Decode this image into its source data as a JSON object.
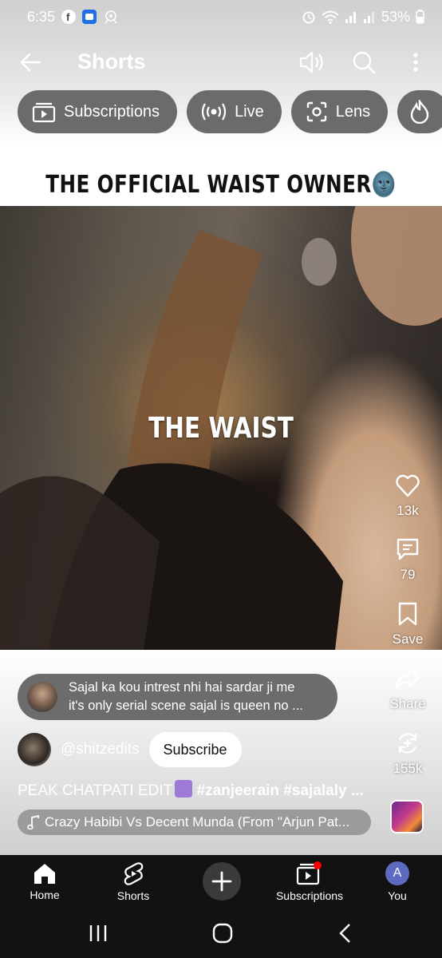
{
  "status_bar": {
    "time": "6:35",
    "battery": "53%",
    "left_icons": [
      "facebook-icon",
      "app-notification-icon",
      "gallery-icon"
    ],
    "right_icons": [
      "alarm-icon",
      "wifi-icon",
      "signal-icon",
      "signal-icon-2",
      "battery-icon"
    ]
  },
  "header": {
    "title": "Shorts",
    "back_icon": "arrow-left-icon",
    "actions": [
      "volume-icon",
      "search-icon",
      "more-vert-icon"
    ]
  },
  "chips": [
    {
      "label": "Subscriptions",
      "icon": "subscriptions-icon"
    },
    {
      "label": "Live",
      "icon": "live-icon"
    },
    {
      "label": "Lens",
      "icon": "lens-icon"
    },
    {
      "label": "",
      "icon": "trending-icon"
    }
  ],
  "video": {
    "top_caption": "THE OFFICIAL WAIST OWNER🌚",
    "mid_caption": "THE WAIST"
  },
  "actions": {
    "like": {
      "label": "13k",
      "icon": "heart-icon"
    },
    "comments": {
      "label": "79",
      "icon": "comment-icon"
    },
    "save": {
      "label": "Save",
      "icon": "bookmark-icon"
    },
    "share": {
      "label": "Share",
      "icon": "share-icon"
    },
    "remix": {
      "label": "155k",
      "icon": "remix-icon"
    }
  },
  "comment": {
    "line1": "Sajal ka kou intrest nhi hai sardar ji me",
    "line2": "it's only serial scene sajal is queen no ..."
  },
  "channel": {
    "name": "@shitzedits",
    "subscribe_label": "Subscribe"
  },
  "title": {
    "prefix": "PEAK CHATPATI EDIT",
    "tags": "#zanjeerain #sajalaly ..."
  },
  "music": {
    "label": "Crazy Habibi Vs Decent Munda (From \"Arjun Pat...",
    "icon": "music-note-icon"
  },
  "bottom_nav": {
    "home": "Home",
    "shorts": "Shorts",
    "subscriptions": "Subscriptions",
    "you": "You",
    "you_initial": "A"
  }
}
